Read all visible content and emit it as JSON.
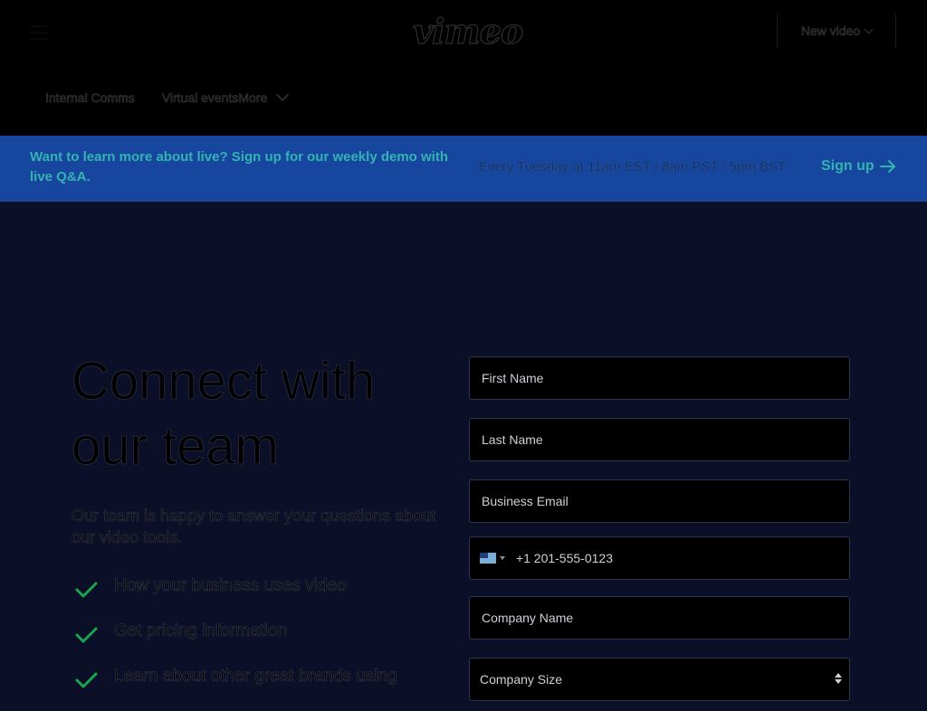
{
  "header": {
    "logo_text": "vimeo",
    "new_video_label": "New video",
    "nav": [
      {
        "label": "Internal Comms"
      },
      {
        "label": "Virtual events"
      },
      {
        "label": "More"
      }
    ]
  },
  "banner": {
    "message": "Want to learn more about live? Sign up for our weekly demo with live Q&A.",
    "schedule": "Every Tuesday at 11am EST / 8am PST / 5pm BST",
    "signup_label": "Sign up"
  },
  "hero": {
    "title": "Connect with our team",
    "intro": "Our team is happy to answer your questions about our video tools.",
    "benefits": [
      {
        "label": "How your business uses video"
      },
      {
        "label": "Get pricing information"
      },
      {
        "label": "Learn about other great brands using"
      }
    ]
  },
  "form": {
    "first_name_placeholder": "First Name",
    "last_name_placeholder": "Last Name",
    "email_placeholder": "Business Email",
    "phone_value": "+1 201-555-0123",
    "company_name_placeholder": "Company Name",
    "company_size_label": "Company Size"
  },
  "colors": {
    "banner_bg": "#17469e",
    "banner_accent": "#34b3b3",
    "page_bg": "#0c0f28",
    "check": "#1aa650"
  }
}
